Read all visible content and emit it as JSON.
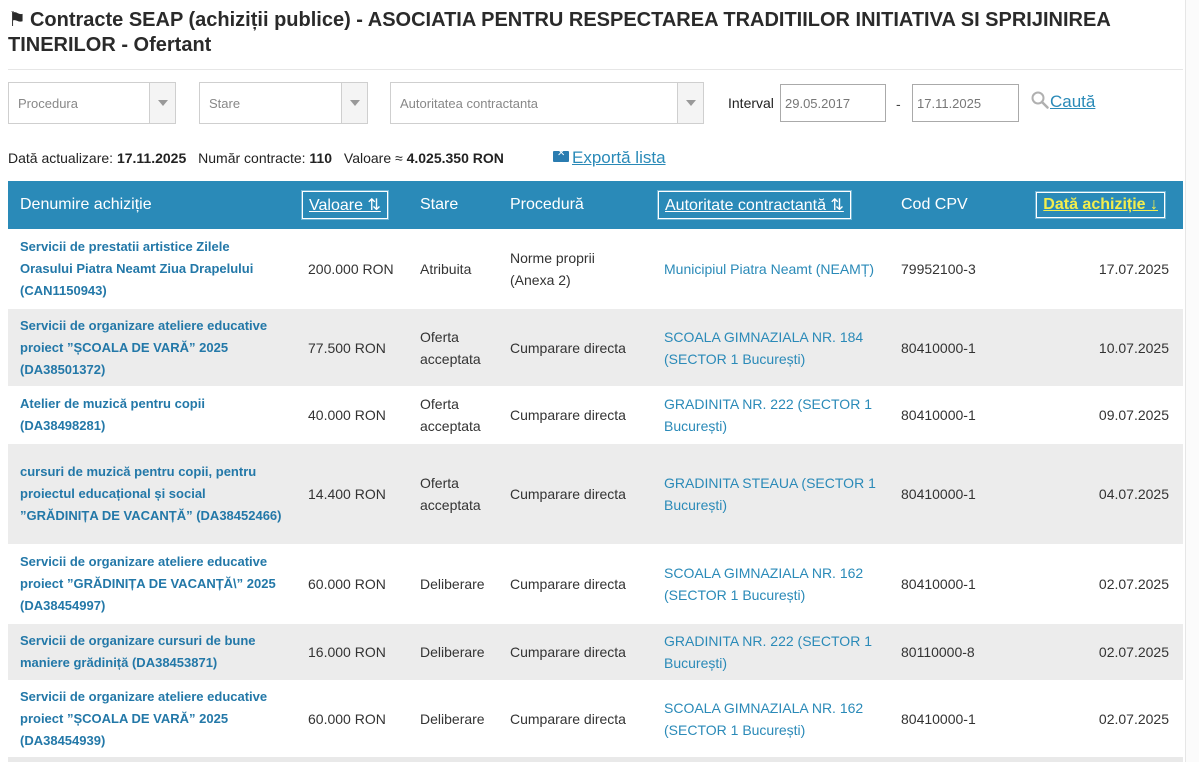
{
  "page": {
    "flag_icon": "⚑",
    "title": "Contracte SEAP (achiziții publice) - ASOCIATIA PENTRU RESPECTAREA TRADITIILOR INITIATIVA SI SPRIJINIREA TINERILOR - Ofertant"
  },
  "filters": {
    "procedura": "Procedura",
    "stare": "Stare",
    "autoritate": "Autoritatea contractanta",
    "interval_label": "Interval",
    "date_from": "29.05.2017",
    "date_sep": "-",
    "date_to": "17.11.2025",
    "search_label": "Caută",
    "search_icon": "magnifier-icon"
  },
  "info": {
    "updated_label": "Dată actualizare:",
    "updated_value": "17.11.2025",
    "count_label": "Număr contracte:",
    "count_value": "110",
    "value_label": "Valoare ≈",
    "value_value": "4.025.350 RON",
    "export_label": "Exportă lista",
    "export_icon": "excel-icon"
  },
  "table": {
    "headers": {
      "denumire": "Denumire achiziție",
      "valoare": "Valoare ⇅",
      "stare": "Stare",
      "procedura": "Procedură",
      "autoritate": "Autoritate contractantă ⇅",
      "cpv": "Cod CPV",
      "data": "Dată achiziție ↓"
    },
    "rows": [
      {
        "name": "Servicii de prestatii artistice Zilele Orasului Piatra Neamt Ziua Drapelului (CAN1150943)",
        "value": "200.000 RON",
        "status": "Atribuita",
        "procedure": "Norme proprii (Anexa 2)",
        "authority": "Municipiul Piatra Neamt (NEAMȚ)",
        "cpv": "79952100-3",
        "date": "17.07.2025"
      },
      {
        "name": "Servicii de organizare ateliere educative proiect ”ȘCOALA DE VARĂ” 2025 (DA38501372)",
        "value": "77.500 RON",
        "status": "Oferta acceptata",
        "procedure": "Cumparare directa",
        "authority": "SCOALA GIMNAZIALA NR. 184 (SECTOR 1 București)",
        "cpv": "80410000-1",
        "date": "10.07.2025"
      },
      {
        "name": "Atelier de muzică pentru copii (DA38498281)",
        "value": "40.000 RON",
        "status": "Oferta acceptata",
        "procedure": "Cumparare directa",
        "authority": "GRADINITA NR. 222 (SECTOR 1 București)",
        "cpv": "80410000-1",
        "date": "09.07.2025"
      },
      {
        "name": "cursuri de muzică pentru copii, pentru proiectul educațional și social ”GRĂDINIȚA DE VACANȚĂ” (DA38452466)",
        "value": "14.400 RON",
        "status": "Oferta acceptata",
        "procedure": "Cumparare directa",
        "authority": "GRADINITA STEAUA (SECTOR 1 București)",
        "cpv": "80410000-1",
        "date": "04.07.2025"
      },
      {
        "name": "Servicii de organizare ateliere educative proiect ”GRĂDINIȚA DE VACANȚĂ\\” 2025 (DA38454997)",
        "value": "60.000 RON",
        "status": "Deliberare",
        "procedure": "Cumparare directa",
        "authority": "SCOALA GIMNAZIALA NR. 162 (SECTOR 1 București)",
        "cpv": "80410000-1",
        "date": "02.07.2025"
      },
      {
        "name": "Servicii de organizare cursuri de bune maniere grădiniță (DA38453871)",
        "value": "16.000 RON",
        "status": "Deliberare",
        "procedure": "Cumparare directa",
        "authority": "GRADINITA NR. 222 (SECTOR 1 București)",
        "cpv": "80110000-8",
        "date": "02.07.2025"
      },
      {
        "name": "Servicii de organizare ateliere educative proiect ”ȘCOALA DE VARĂ” 2025 (DA38454939)",
        "value": "60.000 RON",
        "status": "Deliberare",
        "procedure": "Cumparare directa",
        "authority": "SCOALA GIMNAZIALA NR. 162 (SECTOR 1 București)",
        "cpv": "80410000-1",
        "date": "02.07.2025"
      }
    ]
  },
  "colors": {
    "header_bg": "#2a8ab8",
    "link": "#2378a8",
    "active_sort": "#f4ee4c",
    "row_alt": "#ececec"
  }
}
